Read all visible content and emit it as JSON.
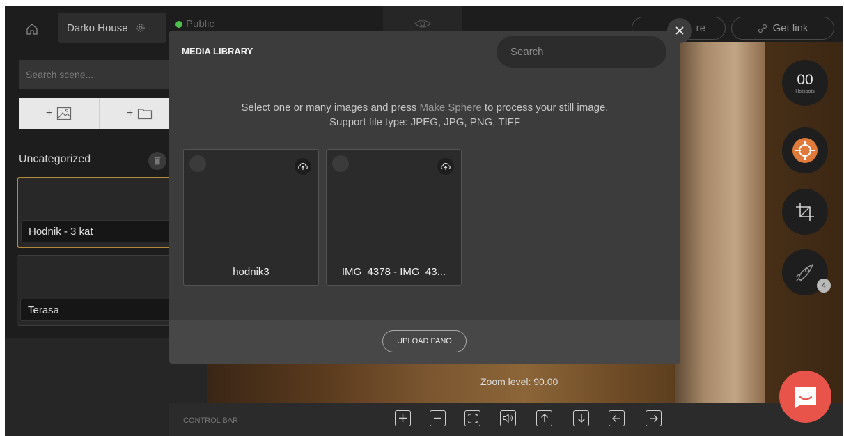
{
  "topbar": {
    "tour_name": "Darko House",
    "visibility": "Public",
    "share_label": "Share",
    "share_visible_label": "re",
    "get_link_label": "Get link"
  },
  "sidebar": {
    "search_placeholder": "Search scene...",
    "add_image_label": "+",
    "add_folder_label": "+",
    "category": "Uncategorized",
    "scenes": [
      {
        "label": "Hodnik - 3 kat",
        "selected": true
      },
      {
        "label": "Terasa",
        "selected": false
      }
    ]
  },
  "viewer": {
    "zoom_text": "Zoom level: 90.00",
    "control_bar_label": "CONTROL BAR"
  },
  "tools": {
    "hotspots_count": "00",
    "hotspots_label": "Hotspots",
    "rocket_badge": "4"
  },
  "modal": {
    "title": "MEDIA LIBRARY",
    "search_placeholder": "Search",
    "info_pre": "Select one or many images and press ",
    "info_highlight": "Make Sphere",
    "info_post": " to process your still image.",
    "info_line2": "Support file type: JPEG, JPG, PNG, TIFF",
    "media": [
      {
        "name": "hodnik3"
      },
      {
        "name": "IMG_4378 - IMG_43..."
      }
    ],
    "upload_label": "UPLOAD PANO"
  },
  "colors": {
    "accent_selected": "#b4893c",
    "public_dot": "#4cc24c",
    "chat": "#e8544a",
    "target_icon": "#e07a3a"
  }
}
